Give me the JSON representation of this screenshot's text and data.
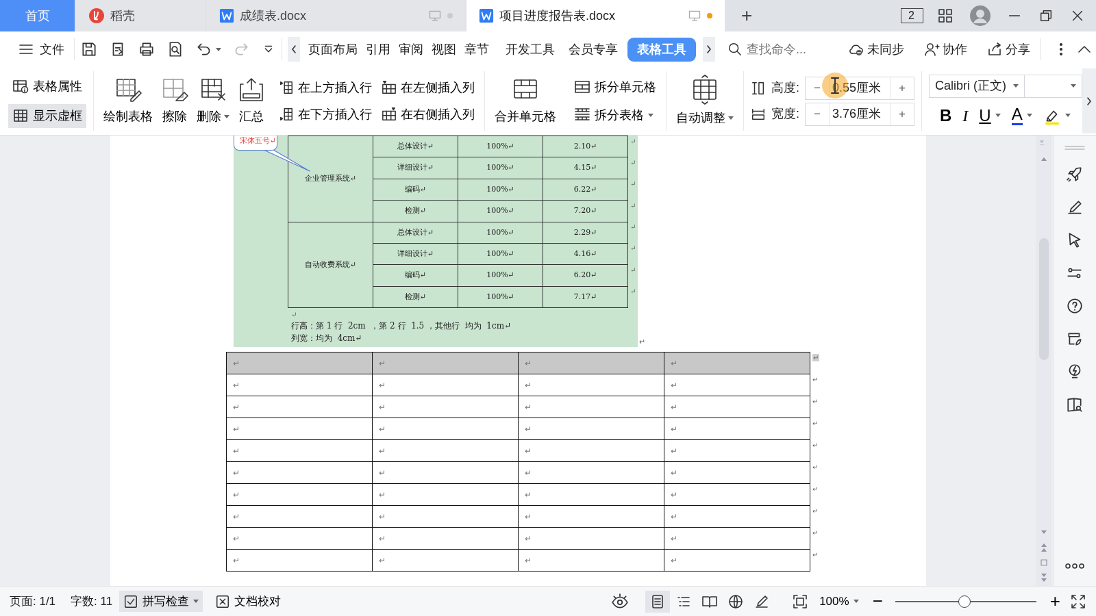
{
  "tabs": [
    {
      "kind": "home",
      "label": "首页",
      "selected": false
    },
    {
      "kind": "app",
      "label": "稻壳",
      "selected": false
    },
    {
      "kind": "doc",
      "label": "成绩表.docx",
      "selected": false,
      "modified": false
    },
    {
      "kind": "doc",
      "label": "项目进度报告表.docx",
      "selected": true,
      "modified": true
    }
  ],
  "new_tab": "+",
  "window_count": "2",
  "file_menu": "文件",
  "menu_tabs": [
    {
      "label": "页面布局",
      "selected": false
    },
    {
      "label": "引用",
      "selected": false
    },
    {
      "label": "审阅",
      "selected": false
    },
    {
      "label": "视图",
      "selected": false
    },
    {
      "label": "章节",
      "selected": false
    },
    {
      "label": "开发工具",
      "selected": false
    },
    {
      "label": "会员专享",
      "selected": false
    },
    {
      "label": "表格工具",
      "selected": true
    }
  ],
  "search": {
    "placeholder": "查找命令..."
  },
  "actions": [
    {
      "kind": "sync",
      "label": "未同步"
    },
    {
      "kind": "collab",
      "label": "协作"
    },
    {
      "kind": "share",
      "label": "分享"
    }
  ],
  "ribbon": {
    "toggles": [
      {
        "kind": "props",
        "label": "表格属性",
        "selected": false
      },
      {
        "kind": "gridlines",
        "label": "显示虚框",
        "selected": true
      }
    ],
    "large": [
      {
        "kind": "draw",
        "label": "绘制表格",
        "dropdown": false
      },
      {
        "kind": "erase",
        "label": "擦除",
        "dropdown": false
      },
      {
        "kind": "delete",
        "label": "删除",
        "dropdown": true
      },
      {
        "kind": "sum",
        "label": "汇总",
        "dropdown": false
      }
    ],
    "insert": [
      {
        "kind": "row-above",
        "label": "在上方插入行"
      },
      {
        "kind": "row-below",
        "label": "在下方插入行"
      },
      {
        "kind": "col-left",
        "label": "在左侧插入列"
      },
      {
        "kind": "col-right",
        "label": "在右侧插入列"
      }
    ],
    "merge": {
      "label": "合并单元格"
    },
    "split": [
      {
        "label": "拆分单元格",
        "dropdown": false
      },
      {
        "label": "拆分表格",
        "dropdown": true
      }
    ],
    "autofit": {
      "label": "自动调整",
      "dropdown": true
    },
    "size": [
      {
        "kind": "height",
        "label": "高度:",
        "minus": "−",
        "value": "0.55厘米",
        "plus": "+"
      },
      {
        "kind": "width",
        "label": "宽度:",
        "minus": "−",
        "value": "3.76厘米",
        "plus": "+"
      }
    ],
    "font": {
      "value": "Calibri (正文)"
    },
    "format": [
      {
        "kind": "bold",
        "label": "B",
        "dropdown": false
      },
      {
        "kind": "italic",
        "label": "I",
        "dropdown": false
      },
      {
        "kind": "underline",
        "label": "U",
        "dropdown": true
      },
      {
        "kind": "color",
        "label": "A",
        "dropdown": true
      },
      {
        "kind": "highlight",
        "dropdown": true
      }
    ]
  },
  "image": {
    "callout": "宋体五号↵",
    "groups": [
      {
        "name": "企业管理系统↵",
        "rows": [
          {
            "cells": [
              "总体设计↵",
              "100%↵",
              "2.10↵"
            ],
            "end_mark": "↵"
          },
          {
            "cells": [
              "详细设计↵",
              "100%↵",
              "4.15↵"
            ],
            "end_mark": "↵"
          },
          {
            "cells": [
              "编码↵",
              "100%↵",
              "6.22↵"
            ],
            "end_mark": "↵"
          },
          {
            "cells": [
              "检测↵",
              "100%↵",
              "7.20↵"
            ],
            "end_mark": "↵"
          }
        ]
      },
      {
        "name": "自动收费系统↵",
        "rows": [
          {
            "cells": [
              "总体设计↵",
              "100%↵",
              "2.29↵"
            ],
            "end_mark": "↵"
          },
          {
            "cells": [
              "详细设计↵",
              "100%↵",
              "4.16↵"
            ],
            "end_mark": "↵"
          },
          {
            "cells": [
              "编码↵",
              "100%↵",
              "6.20↵"
            ],
            "end_mark": "↵"
          },
          {
            "cells": [
              "检测↵",
              "100%↵",
              "7.17↵"
            ],
            "end_mark": "↵"
          }
        ]
      }
    ],
    "blank_mark": "↵",
    "notes": [
      "行高：第 1 行  2cm  ，第 2 行  1.5 ，其他行  均为  1cm↵",
      "列宽：均为  4cm↵"
    ],
    "end_mark": "↵"
  },
  "table": {
    "rows": [
      {
        "shaded": true,
        "cells": [
          "↵",
          "↵",
          "↵",
          "↵"
        ],
        "end_mark": "↵"
      },
      {
        "shaded": false,
        "cells": [
          "↵",
          "↵",
          "↵",
          "↵"
        ],
        "end_mark": "↵"
      },
      {
        "shaded": false,
        "cells": [
          "↵",
          "↵",
          "↵",
          "↵"
        ],
        "end_mark": "↵"
      },
      {
        "shaded": false,
        "cells": [
          "↵",
          "↵",
          "↵",
          "↵"
        ],
        "end_mark": "↵"
      },
      {
        "shaded": false,
        "cells": [
          "↵",
          "↵",
          "↵",
          "↵"
        ],
        "end_mark": "↵"
      },
      {
        "shaded": false,
        "cells": [
          "↵",
          "↵",
          "↵",
          "↵"
        ],
        "end_mark": "↵"
      },
      {
        "shaded": false,
        "cells": [
          "↵",
          "↵",
          "↵",
          "↵"
        ],
        "end_mark": "↵"
      },
      {
        "shaded": false,
        "cells": [
          "↵",
          "↵",
          "↵",
          "↵"
        ],
        "end_mark": "↵"
      },
      {
        "shaded": false,
        "cells": [
          "↵",
          "↵",
          "↵",
          "↵"
        ],
        "end_mark": "↵"
      },
      {
        "shaded": false,
        "cells": [
          "↵",
          "↵",
          "↵",
          "↵"
        ],
        "end_mark": "↵"
      }
    ]
  },
  "status_bar": {
    "page": "页面: 1/1",
    "words": "字数: 11",
    "spell": "拼写检查",
    "proof": "文档校对",
    "views": [
      {
        "kind": "page",
        "selected": true
      },
      {
        "kind": "outline",
        "selected": false
      },
      {
        "kind": "book",
        "selected": false
      },
      {
        "kind": "web",
        "selected": false
      },
      {
        "kind": "write",
        "selected": false
      }
    ],
    "zoom": "100%",
    "zoom_slider": {
      "level": 0.49
    },
    "minus": "−",
    "plus": "+"
  }
}
